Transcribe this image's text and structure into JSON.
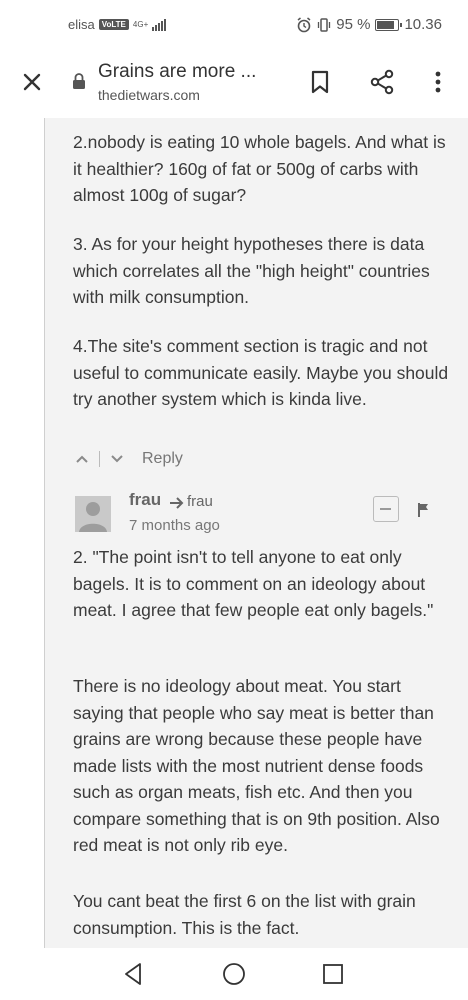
{
  "status_bar": {
    "carrier": "elisa",
    "volte": "VoLTE",
    "network": "4G+",
    "battery": "95 %",
    "time": "10.36"
  },
  "toolbar": {
    "title": "Grains are more ...",
    "url": "thedietwars.com"
  },
  "comments": [
    {
      "paragraphs": [
        "2.nobody is eating 10 whole bagels. And what is it healthier? 160g of fat or 500g of carbs with almost 100g of sugar?",
        "3. As for your height hypotheses there is data which correlates all the \"high height\" countries with milk consumption.",
        "4.The site's comment section is tragic and not useful to communicate easily. Maybe you should try another system which is kinda live."
      ],
      "reply_label": "Reply"
    },
    {
      "author": "frau",
      "reply_to": "frau",
      "time_ago": "7 months ago",
      "paragraphs": [
        "2. \"The point isn't to tell anyone to eat only bagels. It is to comment on an ideology about meat. I agree that few people eat only bagels.\"",
        "There is no ideology about meat. You start saying that people who say meat is better than grains are wrong because these people have made lists with the most nutrient dense foods such as organ meats, fish etc. And then you compare something that is on 9th position. Also red meat is not only rib eye.",
        "You cant beat the first 6 on the list with grain consumption. This is the fact."
      ]
    }
  ],
  "icons": {
    "close": "close-icon",
    "lock": "lock-icon",
    "bookmark": "bookmark-icon",
    "share": "share-icon",
    "menu": "more-vert-icon",
    "upvote": "chevron-up-icon",
    "downvote": "chevron-down-icon",
    "flag": "flag-icon",
    "back": "nav-back-icon",
    "home": "nav-home-icon",
    "recent": "nav-recent-icon"
  }
}
